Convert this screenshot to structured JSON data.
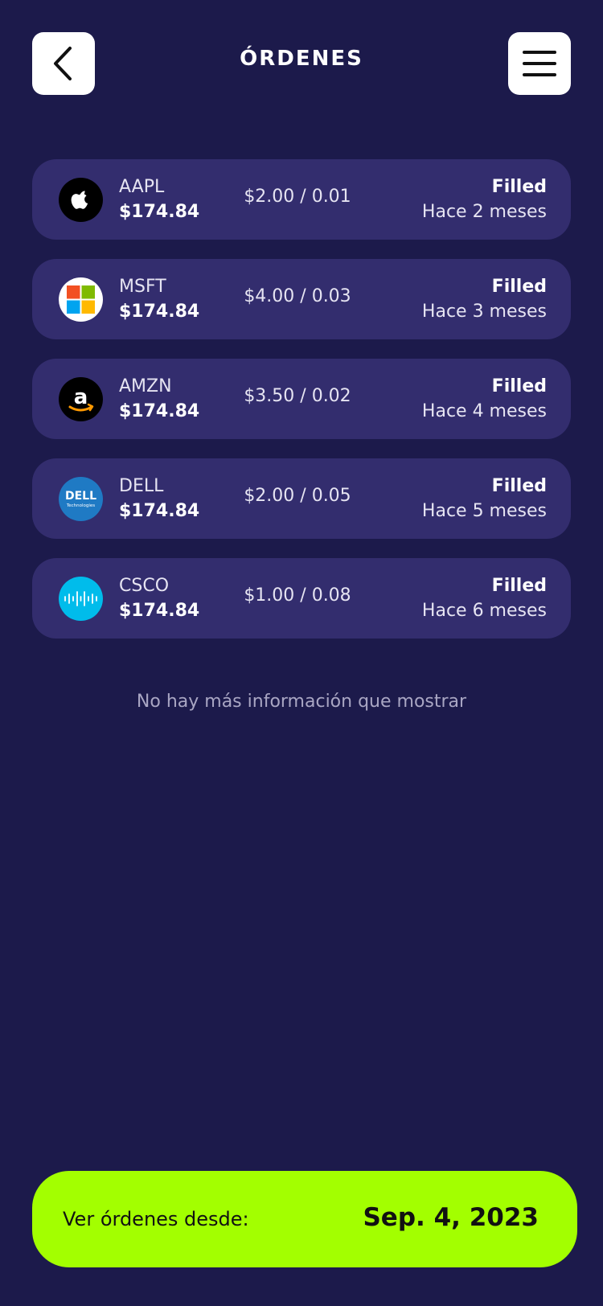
{
  "header": {
    "title": "ÓRDENES",
    "back_icon": "chevron-left-icon",
    "menu_icon": "hamburger-menu-icon"
  },
  "orders": [
    {
      "logo": "apple-logo-icon",
      "ticker": "AAPL",
      "price": "$174.84",
      "amount": "$2.00 / 0.01",
      "status": "Filled",
      "time": "Hace 2 meses"
    },
    {
      "logo": "microsoft-logo-icon",
      "ticker": "MSFT",
      "price": "$174.84",
      "amount": "$4.00 / 0.03",
      "status": "Filled",
      "time": "Hace 3 meses"
    },
    {
      "logo": "amazon-logo-icon",
      "ticker": "AMZN",
      "price": "$174.84",
      "amount": "$3.50 / 0.02",
      "status": "Filled",
      "time": "Hace 4 meses"
    },
    {
      "logo": "dell-logo-icon",
      "ticker": "DELL",
      "price": "$174.84",
      "amount": "$2.00 / 0.05",
      "status": "Filled",
      "time": "Hace 5 meses"
    },
    {
      "logo": "cisco-logo-icon",
      "ticker": "CSCO",
      "price": "$174.84",
      "amount": "$1.00 / 0.08",
      "status": "Filled",
      "time": "Hace 6 meses"
    }
  ],
  "empty_message": "No hay más información que mostrar",
  "date_filter": {
    "label": "Ver órdenes desde:",
    "value": "Sep. 4, 2023"
  },
  "colors": {
    "background": "#1c1a4b",
    "card": "#332d6e",
    "accent": "#a3ff00"
  }
}
